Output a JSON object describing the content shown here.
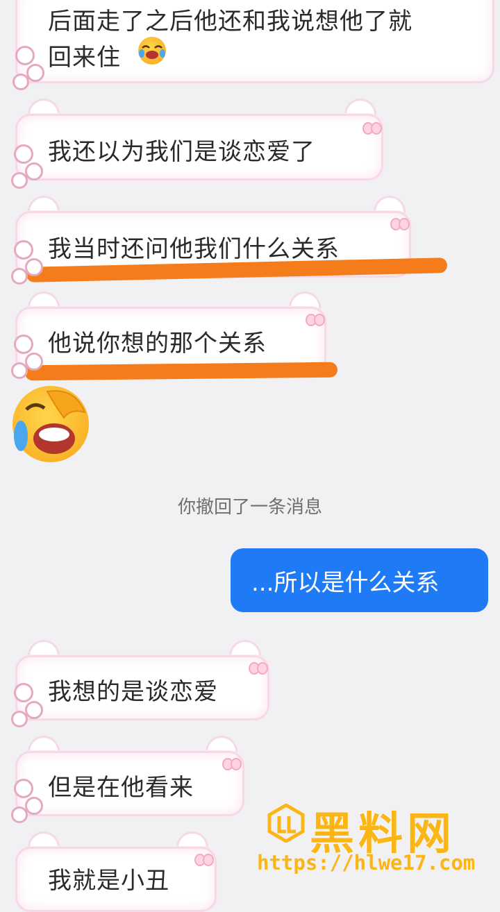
{
  "messages": [
    {
      "sender": "them",
      "text": "后面走了之后他还和我说想他了就",
      "text2": "回来住",
      "emoji": "crying-laughing-face"
    },
    {
      "sender": "them",
      "text": "我还以为我们是谈恋爱了"
    },
    {
      "sender": "them",
      "text": "我当时还问他我们什么关系",
      "highlighted": true
    },
    {
      "sender": "them",
      "text": "他说你想的那个关系",
      "highlighted": true
    },
    {
      "sender": "them",
      "emoji": "crying-laughing-face"
    },
    {
      "sender": "system",
      "text": "你撤回了一条消息"
    },
    {
      "sender": "me",
      "text": "...所以是什么关系"
    },
    {
      "sender": "them",
      "text": "我想的是谈恋爱"
    },
    {
      "sender": "them",
      "text": "但是在他看来"
    },
    {
      "sender": "them",
      "text": "我就是小丑"
    }
  ],
  "watermark": {
    "title": "黑料网",
    "url": "https://hlwe17.com"
  },
  "colors": {
    "sent_bubble": "#1e7bf5",
    "highlight": "#f47c1b",
    "bubble_border": "#f5d9e6",
    "watermark": "#fbb514"
  }
}
